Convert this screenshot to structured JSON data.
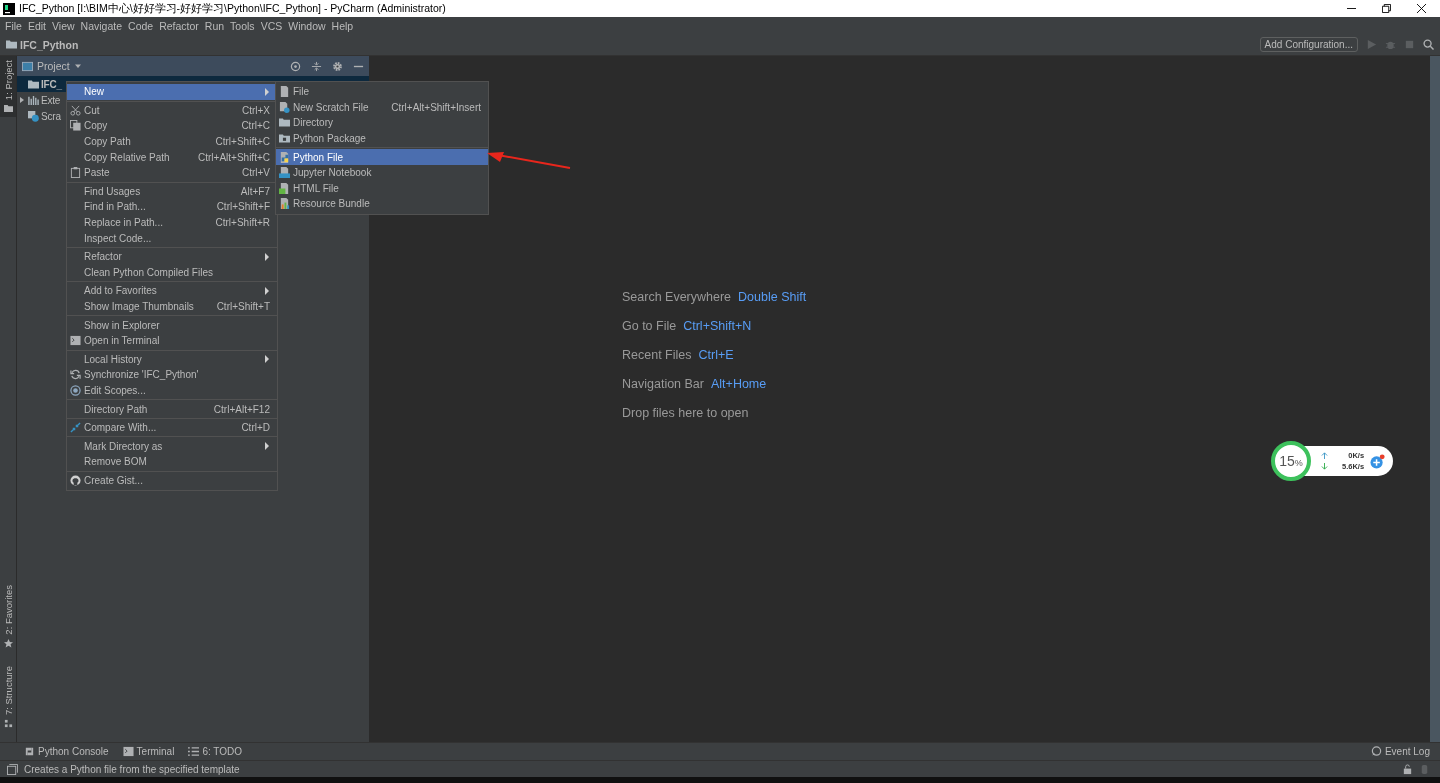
{
  "window": {
    "title": "IFC_Python [I:\\BIM中心\\好好学习-好好学习\\Python\\IFC_Python] - PyCharm (Administrator)"
  },
  "menubar": [
    "File",
    "Edit",
    "View",
    "Navigate",
    "Code",
    "Refactor",
    "Run",
    "Tools",
    "VCS",
    "Window",
    "Help"
  ],
  "navbar": {
    "crumb": "IFC_Python",
    "config_button": "Add Configuration..."
  },
  "left_strip": [
    {
      "label": "1: Project",
      "selected": true
    },
    {
      "label": "2: Favorites",
      "selected": false
    },
    {
      "label": "7: Structure",
      "selected": false
    }
  ],
  "project_panel": {
    "title": "Project",
    "tree": [
      {
        "label": "IFC_",
        "selected": true,
        "expandable": false
      },
      {
        "label": "Exte",
        "selected": false,
        "expandable": true
      },
      {
        "label": "Scra",
        "selected": false,
        "expandable": false
      }
    ]
  },
  "context_menu": {
    "groups": [
      [
        {
          "label": "New",
          "submenu": true,
          "selected": true
        }
      ],
      [
        {
          "label": "Cut",
          "shortcut": "Ctrl+X",
          "submenu": false,
          "selected": false
        },
        {
          "label": "Copy",
          "shortcut": "Ctrl+C",
          "submenu": false,
          "selected": false
        },
        {
          "label": "Copy Path",
          "shortcut": "Ctrl+Shift+C",
          "submenu": false,
          "selected": false
        },
        {
          "label": "Copy Relative Path",
          "shortcut": "Ctrl+Alt+Shift+C",
          "submenu": false,
          "selected": false
        },
        {
          "label": "Paste",
          "shortcut": "Ctrl+V",
          "submenu": false,
          "selected": false
        }
      ],
      [
        {
          "label": "Find Usages",
          "shortcut": "Alt+F7",
          "submenu": false,
          "selected": false
        },
        {
          "label": "Find in Path...",
          "shortcut": "Ctrl+Shift+F",
          "submenu": false,
          "selected": false
        },
        {
          "label": "Replace in Path...",
          "shortcut": "Ctrl+Shift+R",
          "submenu": false,
          "selected": false
        },
        {
          "label": "Inspect Code...",
          "submenu": false,
          "selected": false
        }
      ],
      [
        {
          "label": "Refactor",
          "submenu": true,
          "selected": false
        },
        {
          "label": "Clean Python Compiled Files",
          "submenu": false,
          "selected": false
        }
      ],
      [
        {
          "label": "Add to Favorites",
          "submenu": true,
          "selected": false
        },
        {
          "label": "Show Image Thumbnails",
          "shortcut": "Ctrl+Shift+T",
          "submenu": false,
          "selected": false
        }
      ],
      [
        {
          "label": "Show in Explorer",
          "submenu": false,
          "selected": false
        },
        {
          "label": "Open in Terminal",
          "submenu": false,
          "selected": false
        }
      ],
      [
        {
          "label": "Local History",
          "submenu": true,
          "selected": false
        },
        {
          "label": "Synchronize 'IFC_Python'",
          "submenu": false,
          "selected": false
        },
        {
          "label": "Edit Scopes...",
          "submenu": false,
          "selected": false
        }
      ],
      [
        {
          "label": "Directory Path",
          "shortcut": "Ctrl+Alt+F12",
          "submenu": false,
          "selected": false
        }
      ],
      [
        {
          "label": "Compare With...",
          "shortcut": "Ctrl+D",
          "submenu": false,
          "selected": false
        }
      ],
      [
        {
          "label": "Mark Directory as",
          "submenu": true,
          "selected": false
        },
        {
          "label": "Remove BOM",
          "submenu": false,
          "selected": false
        }
      ],
      [
        {
          "label": "Create Gist...",
          "submenu": false,
          "selected": false
        }
      ]
    ]
  },
  "submenu": {
    "groups": [
      [
        {
          "label": "File",
          "selected": false
        },
        {
          "label": "New Scratch File",
          "shortcut": "Ctrl+Alt+Shift+Insert",
          "selected": false
        },
        {
          "label": "Directory",
          "selected": false
        },
        {
          "label": "Python Package",
          "selected": false
        }
      ],
      [
        {
          "label": "Python File",
          "selected": true
        },
        {
          "label": "Jupyter Notebook",
          "selected": false
        },
        {
          "label": "HTML File",
          "selected": false
        },
        {
          "label": "Resource Bundle",
          "selected": false
        }
      ]
    ]
  },
  "editor_hints": [
    {
      "label": "Search Everywhere",
      "shortcut": "Double Shift"
    },
    {
      "label": "Go to File",
      "shortcut": "Ctrl+Shift+N"
    },
    {
      "label": "Recent Files",
      "shortcut": "Ctrl+E"
    },
    {
      "label": "Navigation Bar",
      "shortcut": "Alt+Home"
    },
    {
      "label": "Drop files here to open"
    }
  ],
  "speed_widget": {
    "percent": "15",
    "unit": "%",
    "upload": "0K/s",
    "download": "5.6K/s"
  },
  "bottom_tabs": [
    "Python Console",
    "Terminal",
    "6: TODO"
  ],
  "event_log": "Event Log",
  "status_bar": {
    "message": "Creates a Python file from the specified template"
  }
}
